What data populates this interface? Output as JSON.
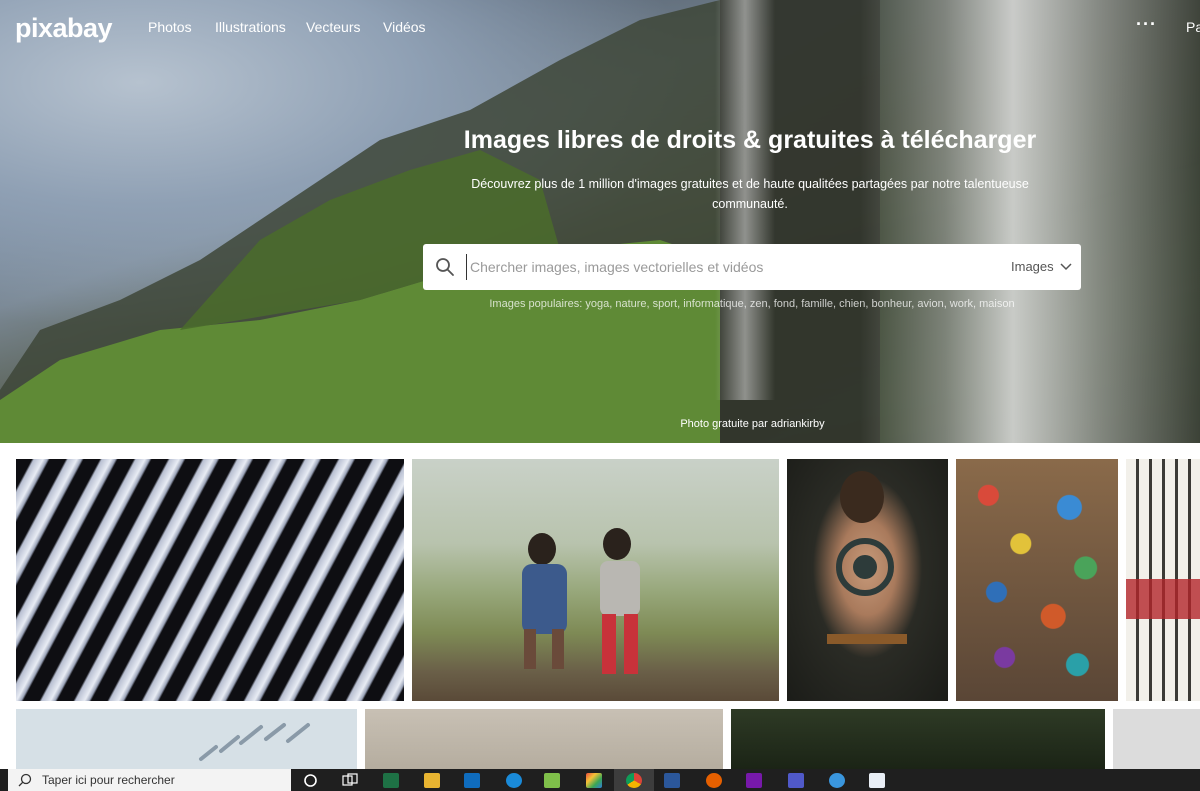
{
  "brand": "pixabay",
  "nav": {
    "items": [
      "Photos",
      "Illustrations",
      "Vecteurs",
      "Vidéos"
    ],
    "more": "···",
    "edge_text": "Pa"
  },
  "hero": {
    "title": "Images libres de droits & gratuites à télécharger",
    "subtitle": "Découvrez plus de 1 million d'images gratuites et de haute qualitées partagées par notre talentueuse communauté.",
    "search": {
      "placeholder": "Chercher images, images vectorielles et vidéos",
      "type_label": "Images"
    },
    "popular": "Images populaires: yoga, nature, sport, informatique, zen, fond, famille, chien, bonheur, avion, work, maison",
    "credit": "Photo gratuite par adriankirby"
  },
  "gallery": {
    "images": [
      "zebra",
      "children",
      "tattoo",
      "pottery",
      "half-timbered-house",
      "sky",
      "wall",
      "trees",
      "grey"
    ]
  },
  "taskbar": {
    "search_text": "Taper ici pour rechercher",
    "apps": [
      "task-view",
      "excel",
      "file-explorer",
      "outlook",
      "edge",
      "notepad",
      "paint",
      "chrome",
      "word",
      "firefox",
      "onenote",
      "teams",
      "cloud-app",
      "document"
    ]
  },
  "colors": {
    "taskbar": "#1f1f1f",
    "search_bg": "#ffffff",
    "hero_text": "#ffffff"
  }
}
